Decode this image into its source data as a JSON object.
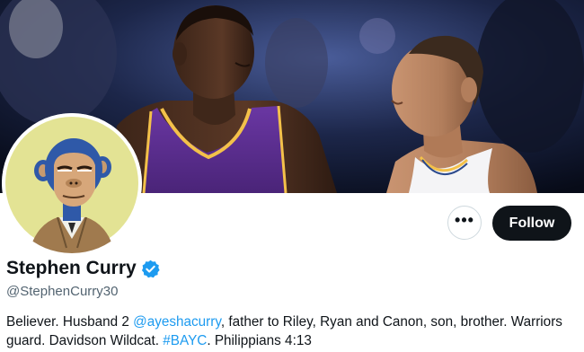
{
  "profile": {
    "name": "Stephen Curry",
    "handle": "@StephenCurry30",
    "verified": true
  },
  "actions": {
    "more_label": "•••",
    "follow_label": "Follow"
  },
  "bio": {
    "part1": "Believer. Husband 2 ",
    "mention": "@ayeshacurry",
    "part2": ", father to Riley, Ryan and Canon, son, brother. Warriors guard. Davidson Wildcat. ",
    "hashtag": "#BAYC",
    "part3": ". Philippians 4:13"
  },
  "images": {
    "banner": "header photo: two basketball players facing each other, one in purple jersey, one in white jersey",
    "avatar": "cartoon ape avatar with blue fur on yellow background"
  },
  "colors": {
    "follow_bg": "#0f1419",
    "link": "#1d9bf0",
    "verified": "#1d9bf0",
    "secondary_text": "#536471",
    "avatar_bg": "#e5e59a",
    "purple_jersey": "#5a2d8c",
    "gold_trim": "#f3c14a"
  }
}
